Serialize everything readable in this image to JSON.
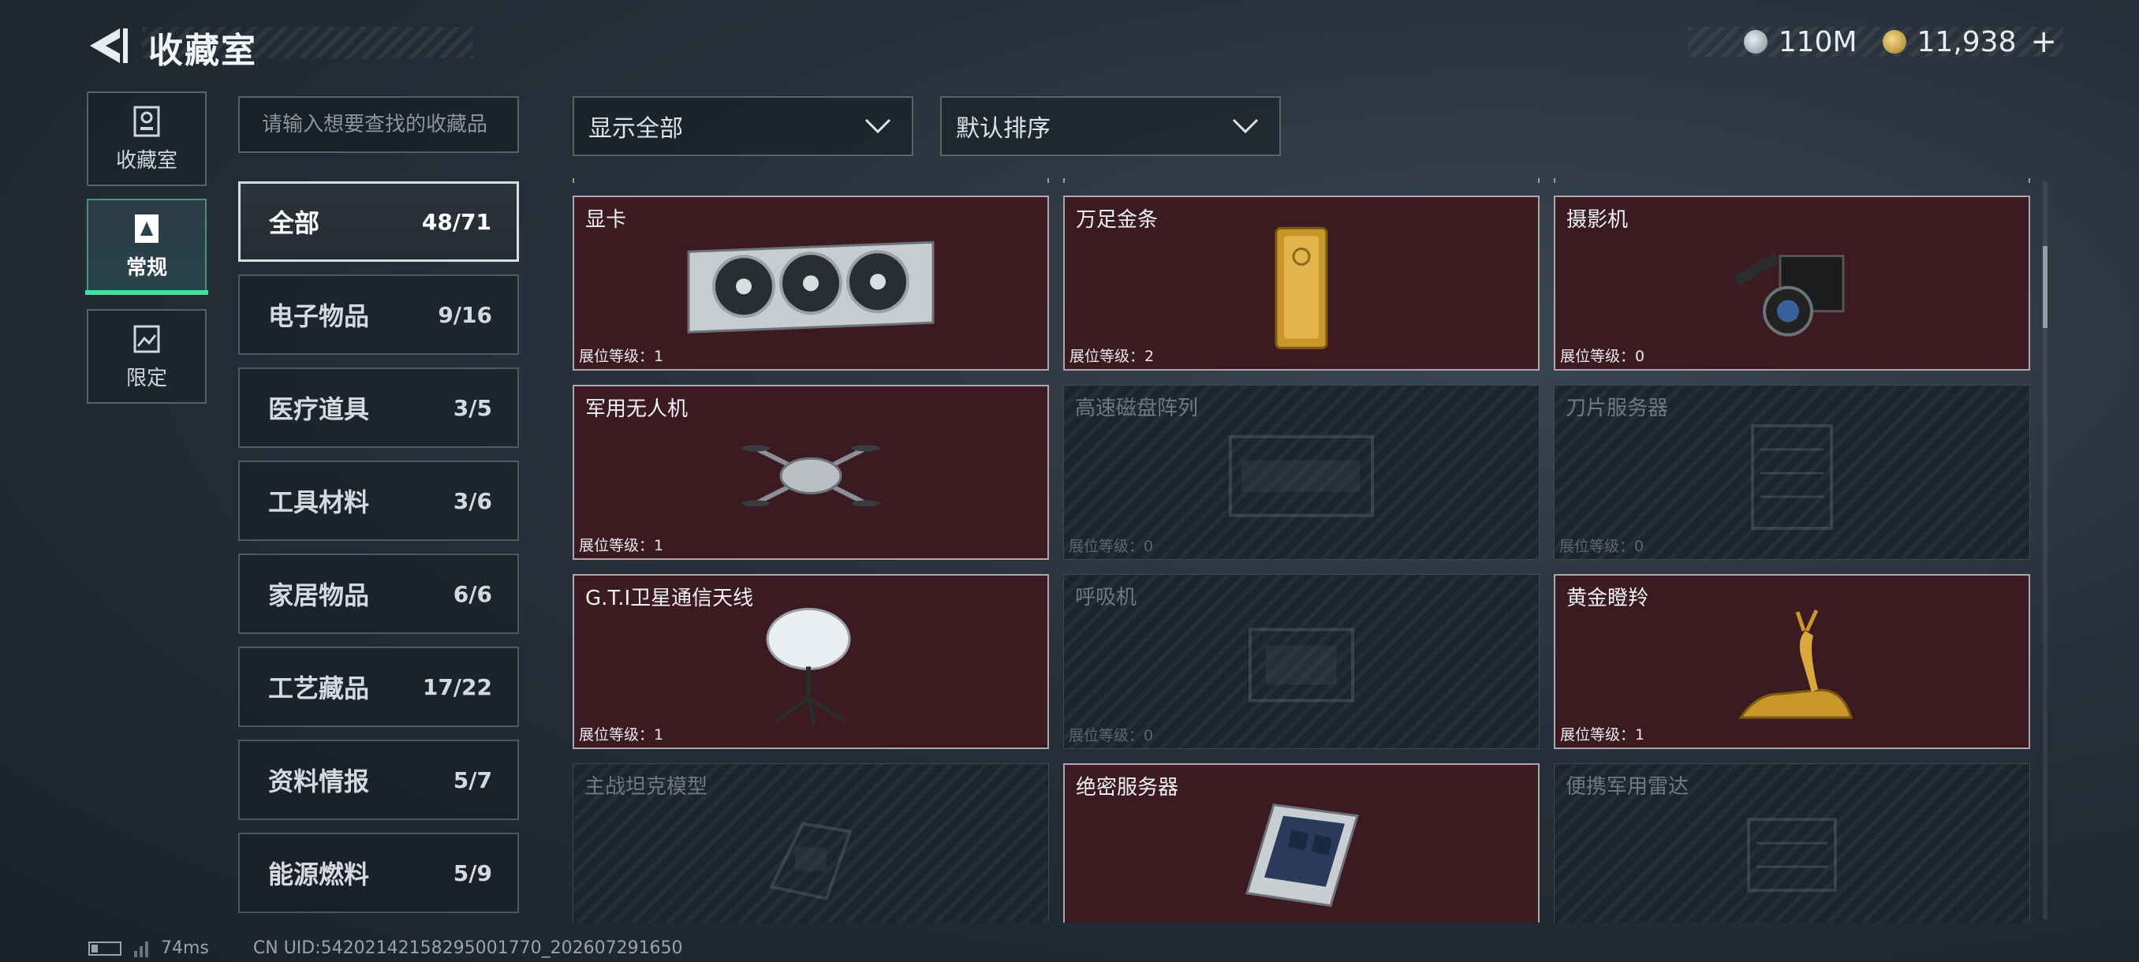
{
  "header": {
    "title": "收藏室",
    "currency_1": "110M",
    "currency_2": "11,938",
    "plus": "+"
  },
  "nav": [
    {
      "label": "收藏室",
      "icon": "trophy-icon"
    },
    {
      "label": "常规",
      "icon": "card-icon",
      "active": true
    },
    {
      "label": "限定",
      "icon": "picture-icon"
    }
  ],
  "search": {
    "placeholder": "请输入想要查找的收藏品",
    "value": ""
  },
  "filters": {
    "display": "显示全部",
    "sort": "默认排序"
  },
  "categories": [
    {
      "name": "全部",
      "count": "48/71",
      "active": true
    },
    {
      "name": "电子物品",
      "count": "9/16"
    },
    {
      "name": "医疗道具",
      "count": "3/5"
    },
    {
      "name": "工具材料",
      "count": "3/6"
    },
    {
      "name": "家居物品",
      "count": "6/6"
    },
    {
      "name": "工艺藏品",
      "count": "17/22"
    },
    {
      "name": "资料情报",
      "count": "5/7"
    },
    {
      "name": "能源燃料",
      "count": "5/9"
    }
  ],
  "items": [
    {
      "name": "显卡",
      "level": "展位等级：1",
      "owned": true,
      "art": "gpu"
    },
    {
      "name": "万足金条",
      "level": "展位等级：2",
      "owned": true,
      "art": "gold-bar"
    },
    {
      "name": "摄影机",
      "level": "展位等级：0",
      "owned": true,
      "art": "camera"
    },
    {
      "name": "军用无人机",
      "level": "展位等级：1",
      "owned": true,
      "art": "drone"
    },
    {
      "name": "高速磁盘阵列",
      "level": "展位等级：0",
      "owned": false,
      "art": "disk-array"
    },
    {
      "name": "刀片服务器",
      "level": "展位等级：0",
      "owned": false,
      "art": "blade-server"
    },
    {
      "name": "G.T.I卫星通信天线",
      "level": "展位等级：1",
      "owned": true,
      "art": "satellite-dish"
    },
    {
      "name": "呼吸机",
      "level": "展位等级：0",
      "owned": false,
      "art": "ventilator"
    },
    {
      "name": "黄金瞪羚",
      "level": "展位等级：1",
      "owned": true,
      "art": "golden-gazelle"
    },
    {
      "name": "主战坦克模型",
      "level": "",
      "owned": false,
      "art": "tank-model"
    },
    {
      "name": "绝密服务器",
      "level": "",
      "owned": true,
      "art": "server"
    },
    {
      "name": "便携军用雷达",
      "level": "",
      "owned": false,
      "art": "radar"
    }
  ],
  "footer": {
    "ping": "74ms",
    "uid": "CN UID:54202142158295001770_202607291650"
  },
  "colors": {
    "accent": "#3fe0a0",
    "owned_card": "#3c1a21",
    "locked_card": "#1c242c"
  }
}
